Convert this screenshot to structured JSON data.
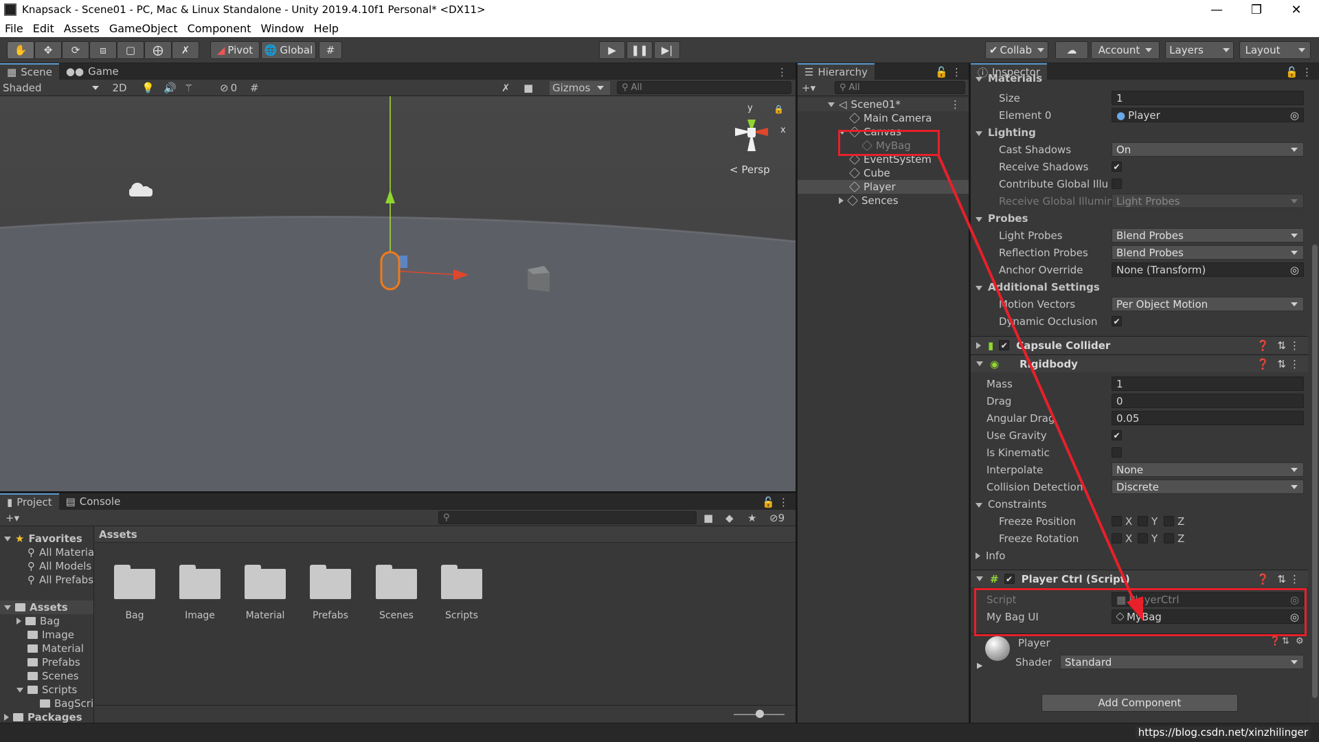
{
  "title": "Knapsack - Scene01 - PC, Mac & Linux Standalone - Unity 2019.4.10f1 Personal* <DX11>",
  "menu": [
    "File",
    "Edit",
    "Assets",
    "GameObject",
    "Component",
    "Window",
    "Help"
  ],
  "toolbar": {
    "pivot": "Pivot",
    "global": "Global",
    "collab": "Collab",
    "account": "Account",
    "layers": "Layers",
    "layout": "Layout"
  },
  "scene": {
    "tabs": [
      "Scene",
      "Game"
    ],
    "shading": "Shaded",
    "mode2d": "2D",
    "hidden_count": "0",
    "gizmos": "Gizmos",
    "search_placeholder": "All",
    "persp": "Persp",
    "axis_y": "y",
    "axis_x": "x"
  },
  "hierarchy": {
    "tab": "Hierarchy",
    "search_placeholder": "All",
    "items": [
      "Scene01*",
      "Main Camera",
      "Canvas",
      "MyBag",
      "EventSystem",
      "Cube",
      "Player",
      "Sences"
    ]
  },
  "inspector": {
    "tab": "Inspector",
    "materials": "Materials",
    "size_label": "Size",
    "size_value": "1",
    "element0_label": "Element 0",
    "element0_value": "Player",
    "lighting": "Lighting",
    "cast_shadows_label": "Cast Shadows",
    "cast_shadows_value": "On",
    "receive_shadows_label": "Receive Shadows",
    "contribute_gi_label": "Contribute Global Illun",
    "receive_gi_label": "Receive Global Illumin",
    "receive_gi_value": "Light Probes",
    "probes": "Probes",
    "light_probes_label": "Light Probes",
    "light_probes_value": "Blend Probes",
    "reflection_probes_label": "Reflection Probes",
    "reflection_probes_value": "Blend Probes",
    "anchor_label": "Anchor Override",
    "anchor_value": "None (Transform)",
    "additional": "Additional Settings",
    "motion_label": "Motion Vectors",
    "motion_value": "Per Object Motion",
    "dynamic_label": "Dynamic Occlusion",
    "capsule": "Capsule Collider",
    "rigidbody": "Rigidbody",
    "mass_label": "Mass",
    "mass_value": "1",
    "drag_label": "Drag",
    "drag_value": "0",
    "angular_label": "Angular Drag",
    "angular_value": "0.05",
    "gravity_label": "Use Gravity",
    "kinematic_label": "Is Kinematic",
    "interpolate_label": "Interpolate",
    "interpolate_value": "None",
    "collision_label": "Collision Detection",
    "collision_value": "Discrete",
    "constraints": "Constraints",
    "freeze_pos_label": "Freeze Position",
    "freeze_rot_label": "Freeze Rotation",
    "x": "X",
    "y": "Y",
    "z": "Z",
    "info": "Info",
    "playerctrl": "Player Ctrl (Script)",
    "script_label": "Script",
    "script_value": "PlayerCtrl",
    "mybagui_label": "My Bag UI",
    "mybagui_value": "MyBag",
    "material_name": "Player",
    "shader_label": "Shader",
    "shader_value": "Standard",
    "add_component": "Add Component"
  },
  "project": {
    "tabs": [
      "Project",
      "Console"
    ],
    "hidden_count": "9",
    "favorites": "Favorites",
    "fav_items": [
      "All Materia",
      "All Models",
      "All Prefabs"
    ],
    "assets": "Assets",
    "tree": [
      "Bag",
      "Image",
      "Material",
      "Prefabs",
      "Scenes",
      "Scripts"
    ],
    "sub_tree": [
      "BagScri"
    ],
    "packages": "Packages",
    "breadcrumb": "Assets",
    "folders": [
      "Bag",
      "Image",
      "Material",
      "Prefabs",
      "Scenes",
      "Scripts"
    ]
  },
  "watermark": "https://blog.csdn.net/xinzhilinger"
}
